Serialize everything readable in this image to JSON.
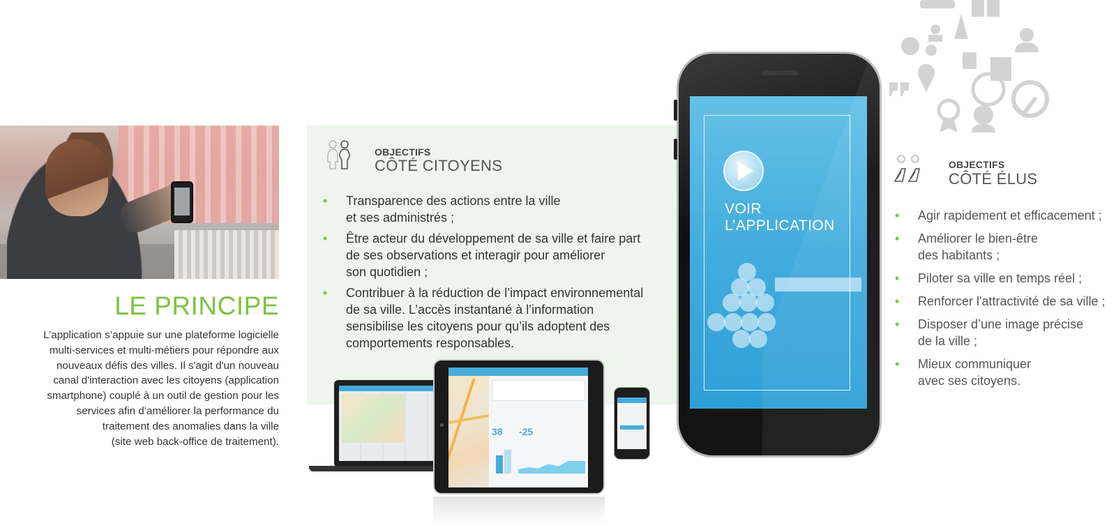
{
  "principe": {
    "title": "LE PRINCIPE",
    "lines": [
      "L’application s’appuie sur une plateforme logicielle",
      "multi-services et multi-métiers pour répondre aux",
      "nouveaux défis des villes. Il s'agit d'un nouveau",
      "canal d'interaction avec les citoyens (application",
      "smartphone) couplé à un outil de gestion pour les",
      "services afin d’améliorer la performance du",
      "traitement des anomalies dans la ville",
      "(site web back-office de traitement)."
    ]
  },
  "citoyens": {
    "label": "OBJECTIFS",
    "title": "CÔTÉ CITOYENS",
    "items": [
      [
        "Transparence des actions entre la ville",
        "et ses administrés ;"
      ],
      [
        "Être acteur du développement de sa ville et faire part",
        "de ses observations et interagir pour améliorer",
        "son quotidien ;"
      ],
      [
        "Contribuer à la réduction de l’impact environnemental",
        "de sa ville. L’accès instantané à l’information",
        "sensibilise les citoyens pour qu’ils adoptent des",
        "comportements responsables."
      ]
    ]
  },
  "app": {
    "cta_line1": "VOIR",
    "cta_line2": "L’APPLICATION"
  },
  "elus": {
    "label": "OBJECTIFS",
    "title": "CÔTÉ ÉLUS",
    "items": [
      [
        "Agir rapidement et efficacement ;"
      ],
      [
        "Améliorer le bien-être",
        "des habitants ;"
      ],
      [
        "Piloter sa ville en temps réel ;"
      ],
      [
        "Renforcer l'attractivité de sa ville ;"
      ],
      [
        "Disposer d’une image précise",
        "de la ville ;"
      ],
      [
        "Mieux communiquer",
        "avec ses citoyens."
      ]
    ]
  },
  "tablet": {
    "stat_1": "38",
    "stat_2": "-25"
  },
  "colors": {
    "accent_green": "#7dc242",
    "app_blue": "#42acdd",
    "panel_bg": "#eef5ec"
  },
  "icons": [
    "people-icon",
    "play-icon",
    "city-services-icons",
    "officials-icon"
  ]
}
